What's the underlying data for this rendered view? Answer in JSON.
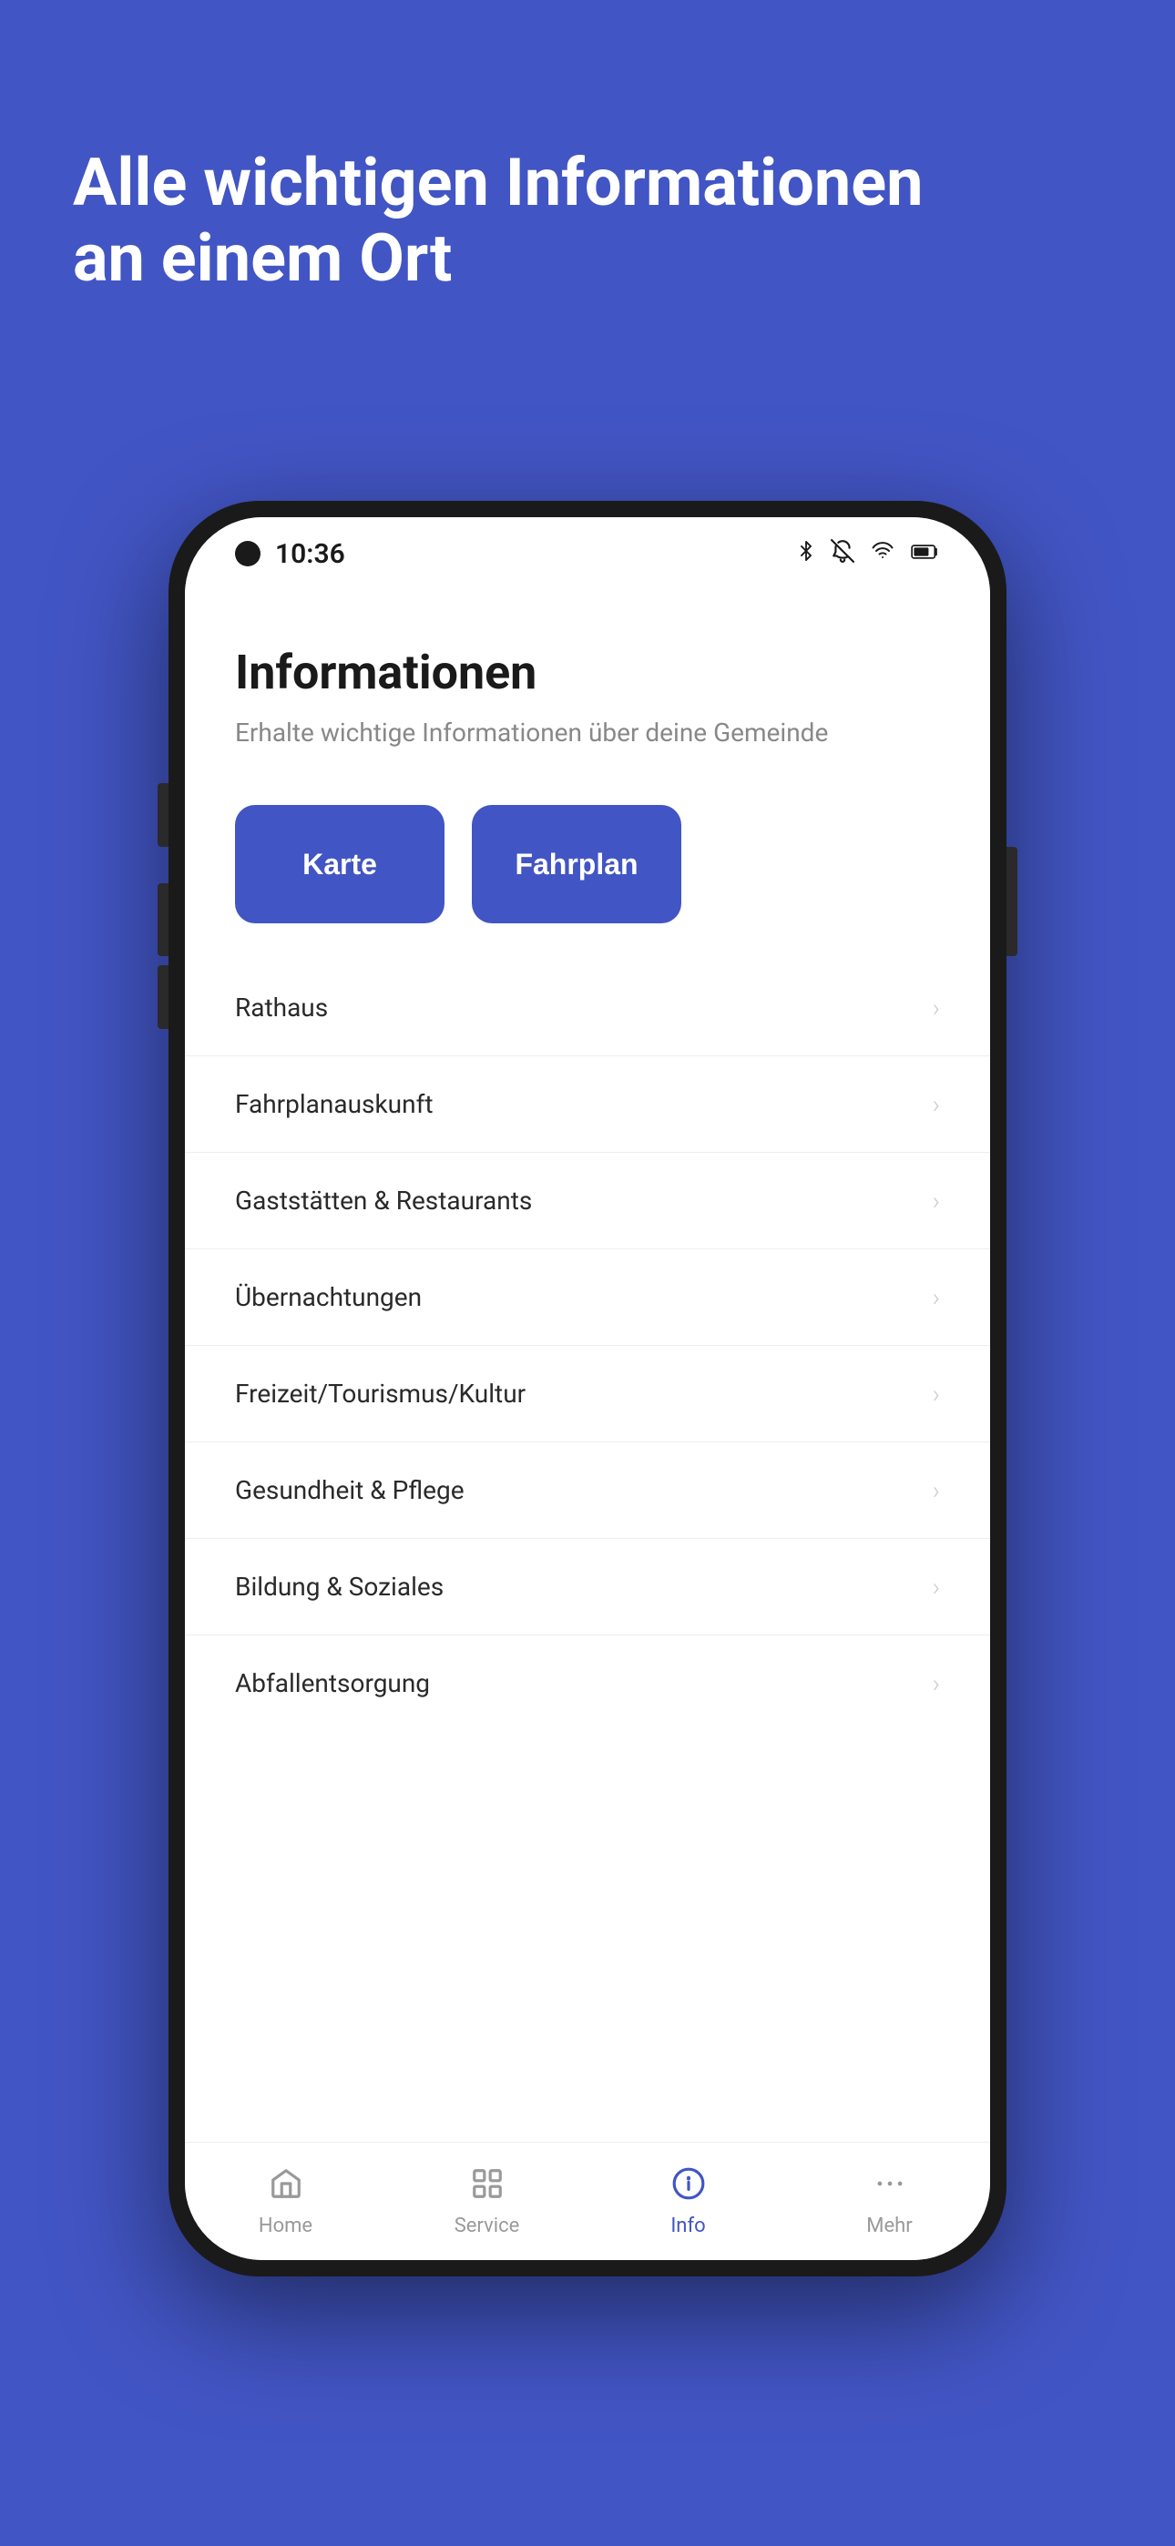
{
  "background_color": "#4255c4",
  "headline": {
    "line1": "Alle wichtigen Informationen",
    "line2": "an einem Ort",
    "full": "Alle wichtigen Informationen an einem Ort"
  },
  "phone": {
    "status_bar": {
      "time": "10:36",
      "icons": [
        "bluetooth",
        "bell-off",
        "wifi",
        "battery"
      ]
    },
    "app": {
      "title": "Informationen",
      "subtitle": "Erhalte wichtige Informationen über deine Gemeinde",
      "quick_actions": [
        {
          "id": "karte",
          "label": "Karte"
        },
        {
          "id": "fahrplan",
          "label": "Fahrplan"
        }
      ],
      "menu_items": [
        {
          "id": "rathaus",
          "label": "Rathaus"
        },
        {
          "id": "fahrplanauskunft",
          "label": "Fahrplanauskunft"
        },
        {
          "id": "gaststaetten",
          "label": "Gaststätten & Restaurants"
        },
        {
          "id": "uebernachtungen",
          "label": "Übernachtungen"
        },
        {
          "id": "freizeit",
          "label": "Freizeit/Tourismus/Kultur"
        },
        {
          "id": "gesundheit",
          "label": "Gesundheit & Pflege"
        },
        {
          "id": "bildung",
          "label": "Bildung & Soziales"
        },
        {
          "id": "abfallentsorgung",
          "label": "Abfallentsorgung"
        }
      ]
    },
    "bottom_nav": [
      {
        "id": "home",
        "label": "Home",
        "active": false
      },
      {
        "id": "service",
        "label": "Service",
        "active": false
      },
      {
        "id": "info",
        "label": "Info",
        "active": true
      },
      {
        "id": "mehr",
        "label": "Mehr",
        "active": false
      }
    ]
  }
}
